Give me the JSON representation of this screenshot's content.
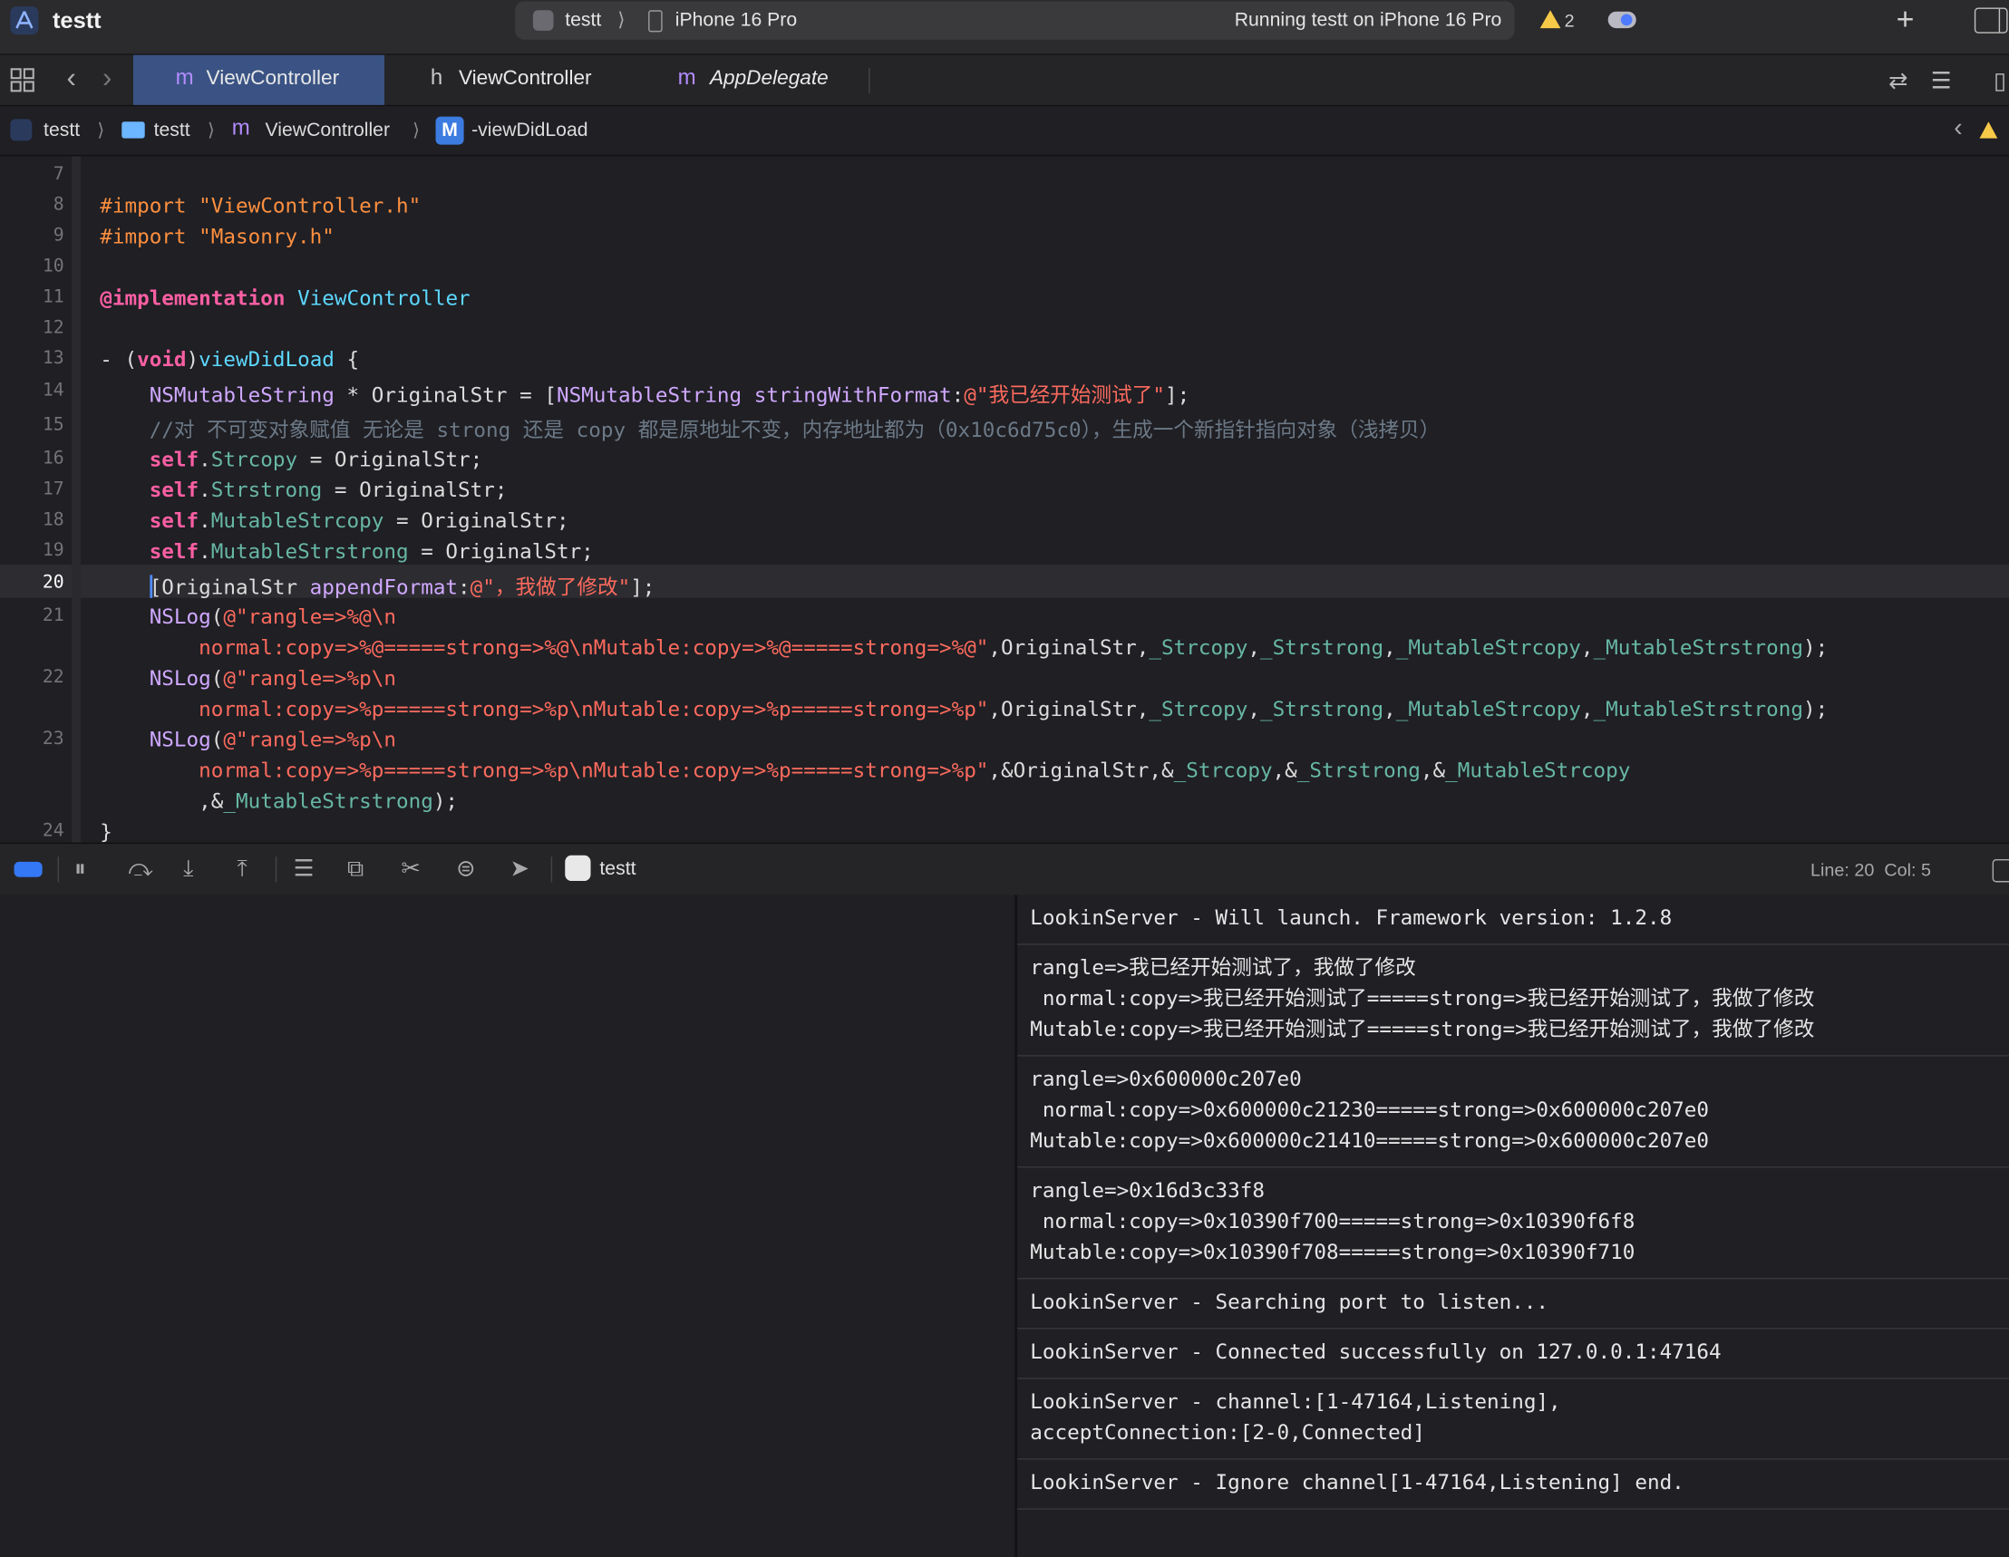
{
  "window": {
    "title": "testt",
    "scheme": "testt",
    "scheme_separator": "⟩",
    "device": "iPhone 16 Pro",
    "run_status": "Running testt on iPhone 16 Pro",
    "warning_count": "2",
    "add_button": "+"
  },
  "tabs": [
    {
      "glyph": "m",
      "label": "ViewController",
      "active": true
    },
    {
      "glyph": "h",
      "label": "ViewController",
      "active": false
    },
    {
      "glyph": "m",
      "label": "AppDelegate",
      "active": false
    }
  ],
  "breadcrumb": {
    "items": [
      "testt",
      "testt",
      "ViewController",
      "-viewDidLoad"
    ],
    "separator": "⟩",
    "m_glyph": "m",
    "method_glyph": "M"
  },
  "editor": {
    "line_numbers": [
      "7",
      "8",
      "9",
      "10",
      "11",
      "12",
      "13",
      "14",
      "15",
      "16",
      "17",
      "18",
      "19",
      "20",
      "21",
      "",
      "22",
      "",
      "23",
      "",
      "",
      "24"
    ],
    "current_line": "20"
  },
  "debug_bar": {
    "target": "testt",
    "line": "Line: 20",
    "col": "Col: 5"
  },
  "console": {
    "entries": [
      "LookinServer - Will launch. Framework version: 1.2.8",
      "rangle=>我已经开始测试了，我做了修改\n normal:copy=>我已经开始测试了=====strong=>我已经开始测试了，我做了修改\nMutable:copy=>我已经开始测试了=====strong=>我已经开始测试了，我做了修改",
      "rangle=>0x600000c207e0\n normal:copy=>0x600000c21230=====strong=>0x600000c207e0\nMutable:copy=>0x600000c21410=====strong=>0x600000c207e0",
      "rangle=>0x16d3c33f8\n normal:copy=>0x10390f700=====strong=>0x10390f6f8\nMutable:copy=>0x10390f708=====strong=>0x10390f710",
      "LookinServer - Searching port to listen...",
      "LookinServer - Connected successfully on 127.0.0.1:47164",
      "LookinServer - channel:[1-47164,Listening],\nacceptConnection:[2-0,Connected]",
      "LookinServer - Ignore channel[1-47164,Listening] end."
    ]
  },
  "colors": {
    "accent": "#3478f6",
    "active_tab": "#3a5384",
    "keyword": "#fc5fa3",
    "string": "#fc6a5d",
    "preprocessor": "#fd8f3f",
    "class": "#5dd8ff",
    "comment": "#6c7986"
  }
}
